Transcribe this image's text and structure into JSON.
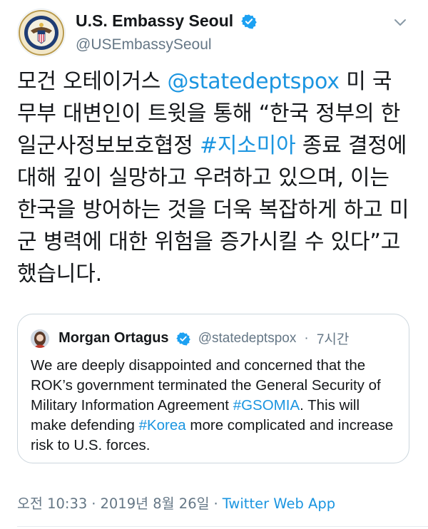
{
  "author": {
    "display_name": "U.S. Embassy Seoul",
    "handle": "@USEmbassySeoul",
    "avatar_icon": "embassy-seal-icon",
    "verified_icon": "verified-badge-icon"
  },
  "tweet": {
    "text_parts": [
      "모건 오테이거스 ",
      "@statedeptspox",
      " 미 국무부 대변인이 트윗을 통해 “한국 정부의 한일군사정보보호협정 ",
      "#지소미아",
      " 종료 결정에 대해 깊이 실망하고 우려하고 있으며, 이는 한국을 방어하는 것을 더욱 복잡하게 하고 미군 병력에 대한 위험을 증가시킬 수 있다”고 했습니다."
    ]
  },
  "quoted_tweet": {
    "display_name": "Morgan Ortagus",
    "handle": "@statedeptspox",
    "dot": "·",
    "time": "7시간",
    "text_parts": [
      "We are deeply disappointed and concerned that the ROK’s government terminated the General Security of Military Information Agreement ",
      "#GSOMIA",
      ". This will make defending ",
      "#Korea",
      " more complicated and increase risk to U.S. forces."
    ]
  },
  "meta": {
    "time": "오전 10:33",
    "sep1": "·",
    "date": "2019년 8월 26일",
    "sep2": "·",
    "source": "Twitter Web App"
  },
  "colors": {
    "link": "#1b95e0",
    "secondary_text": "#657786",
    "primary_text": "#14171a",
    "border": "#ccd6dd"
  }
}
